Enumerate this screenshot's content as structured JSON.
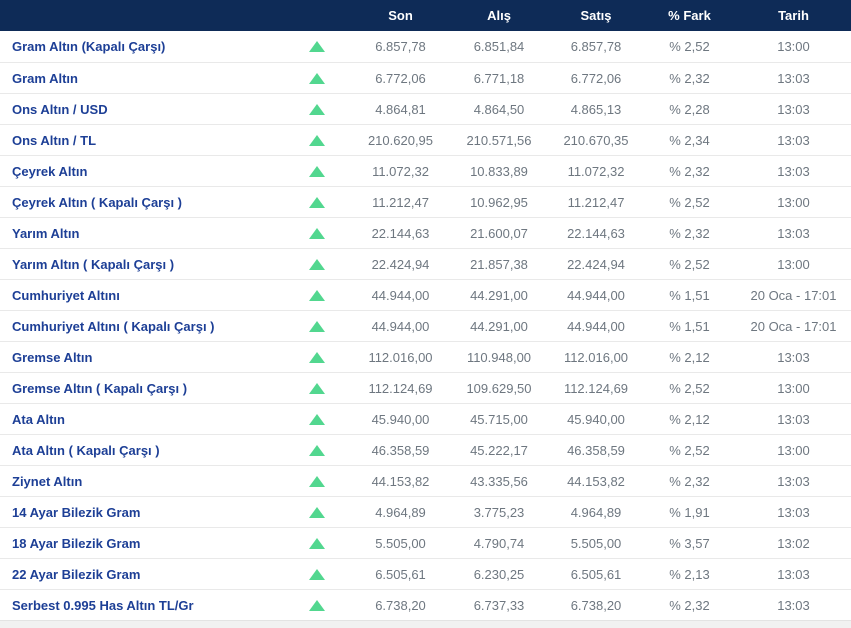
{
  "table": {
    "columns": [
      "Son",
      "Alış",
      "Satış",
      "% Fark",
      "Tarih"
    ],
    "rows": [
      {
        "name": "Gram Altın (Kapalı Çarşı)",
        "trend": "up",
        "son": "6.857,78",
        "alis": "6.851,84",
        "satis": "6.857,78",
        "fark": "% 2,52",
        "tarih": "13:00"
      },
      {
        "name": "Gram Altın",
        "trend": "up",
        "son": "6.772,06",
        "alis": "6.771,18",
        "satis": "6.772,06",
        "fark": "% 2,32",
        "tarih": "13:03"
      },
      {
        "name": "Ons Altın / USD",
        "trend": "up",
        "son": "4.864,81",
        "alis": "4.864,50",
        "satis": "4.865,13",
        "fark": "% 2,28",
        "tarih": "13:03"
      },
      {
        "name": "Ons Altın / TL",
        "trend": "up",
        "son": "210.620,95",
        "alis": "210.571,56",
        "satis": "210.670,35",
        "fark": "% 2,34",
        "tarih": "13:03"
      },
      {
        "name": "Çeyrek Altın",
        "trend": "up",
        "son": "11.072,32",
        "alis": "10.833,89",
        "satis": "11.072,32",
        "fark": "% 2,32",
        "tarih": "13:03"
      },
      {
        "name": "Çeyrek Altın ( Kapalı Çarşı )",
        "trend": "up",
        "son": "11.212,47",
        "alis": "10.962,95",
        "satis": "11.212,47",
        "fark": "% 2,52",
        "tarih": "13:00"
      },
      {
        "name": "Yarım Altın",
        "trend": "up",
        "son": "22.144,63",
        "alis": "21.600,07",
        "satis": "22.144,63",
        "fark": "% 2,32",
        "tarih": "13:03"
      },
      {
        "name": "Yarım Altın ( Kapalı Çarşı )",
        "trend": "up",
        "son": "22.424,94",
        "alis": "21.857,38",
        "satis": "22.424,94",
        "fark": "% 2,52",
        "tarih": "13:00"
      },
      {
        "name": "Cumhuriyet Altını",
        "trend": "up",
        "son": "44.944,00",
        "alis": "44.291,00",
        "satis": "44.944,00",
        "fark": "% 1,51",
        "tarih": "20 Oca - 17:01"
      },
      {
        "name": "Cumhuriyet Altını ( Kapalı Çarşı )",
        "trend": "up",
        "son": "44.944,00",
        "alis": "44.291,00",
        "satis": "44.944,00",
        "fark": "% 1,51",
        "tarih": "20 Oca - 17:01"
      },
      {
        "name": "Gremse Altın",
        "trend": "up",
        "son": "112.016,00",
        "alis": "110.948,00",
        "satis": "112.016,00",
        "fark": "% 2,12",
        "tarih": "13:03"
      },
      {
        "name": "Gremse Altın ( Kapalı Çarşı )",
        "trend": "up",
        "son": "112.124,69",
        "alis": "109.629,50",
        "satis": "112.124,69",
        "fark": "% 2,52",
        "tarih": "13:00"
      },
      {
        "name": "Ata Altın",
        "trend": "up",
        "son": "45.940,00",
        "alis": "45.715,00",
        "satis": "45.940,00",
        "fark": "% 2,12",
        "tarih": "13:03"
      },
      {
        "name": "Ata Altın ( Kapalı Çarşı )",
        "trend": "up",
        "son": "46.358,59",
        "alis": "45.222,17",
        "satis": "46.358,59",
        "fark": "% 2,52",
        "tarih": "13:00"
      },
      {
        "name": "Ziynet Altın",
        "trend": "up",
        "son": "44.153,82",
        "alis": "43.335,56",
        "satis": "44.153,82",
        "fark": "% 2,32",
        "tarih": "13:03"
      },
      {
        "name": "14 Ayar Bilezik Gram",
        "trend": "up",
        "son": "4.964,89",
        "alis": "3.775,23",
        "satis": "4.964,89",
        "fark": "% 1,91",
        "tarih": "13:03"
      },
      {
        "name": "18 Ayar Bilezik Gram",
        "trend": "up",
        "son": "5.505,00",
        "alis": "4.790,74",
        "satis": "5.505,00",
        "fark": "% 3,57",
        "tarih": "13:02"
      },
      {
        "name": "22 Ayar Bilezik Gram",
        "trend": "up",
        "son": "6.505,61",
        "alis": "6.230,25",
        "satis": "6.505,61",
        "fark": "% 2,13",
        "tarih": "13:03"
      },
      {
        "name": "Serbest 0.995 Has Altın TL/Gr",
        "trend": "up",
        "son": "6.738,20",
        "alis": "6.737,33",
        "satis": "6.738,20",
        "fark": "% 2,32",
        "tarih": "13:03"
      }
    ]
  },
  "colors": {
    "header_bg": "#0e2b57",
    "instrument_name": "#1d3f96",
    "value_text": "#6e7780",
    "trend_up": "#52d78f",
    "row_separator": "#e9e9e9",
    "footer_strip_bg": "#f1f1f1"
  },
  "icons": {
    "trend_up": "triangle-up-icon"
  }
}
